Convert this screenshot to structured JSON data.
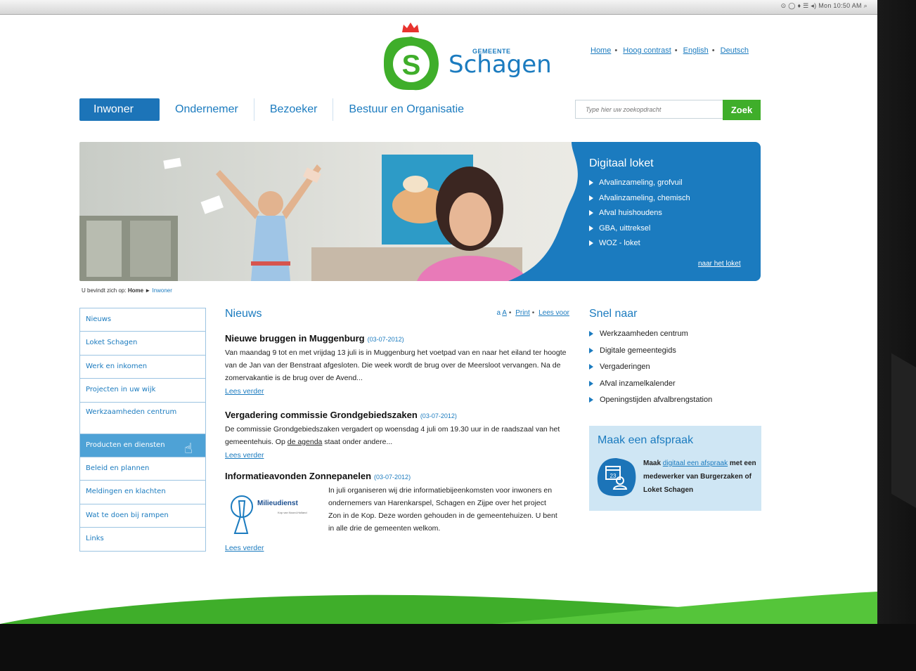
{
  "menubar": {
    "status": "⊙ ◯ ♦ ☰ ◂) Mon 10:50 AM ⌕"
  },
  "header": {
    "logo_small": "GEMEENTE",
    "logo_name": "Schagen",
    "links": [
      "Home",
      "Hoog contrast",
      "English",
      "Deutsch"
    ]
  },
  "nav": {
    "tabs": [
      "Inwoner",
      "Ondernemer",
      "Bezoeker",
      "Bestuur en Organisatie"
    ]
  },
  "search": {
    "placeholder": "Type hier uw zoekopdracht",
    "button": "Zoek"
  },
  "hero": {
    "title": "Digitaal loket",
    "items": [
      "Afvalinzameling, grofvuil",
      "Afvalinzameling, chemisch",
      "Afval huishoudens",
      "GBA, uittreksel",
      "WOZ - loket"
    ],
    "more": "naar het loket"
  },
  "breadcrumb": {
    "prefix": "U bevindt zich op:",
    "home": "Home",
    "sep": "►",
    "current": "Inwoner"
  },
  "sidebar": {
    "items": [
      "Nieuws",
      "Loket Schagen",
      "Werk en inkomen",
      "Projecten in uw wijk",
      "Werkzaamheden centrum",
      "Producten en diensten",
      "Beleid en plannen",
      "Meldingen en klachten",
      "Wat te doen bij rampen",
      "Links"
    ]
  },
  "news": {
    "title": "Nieuws",
    "tools": {
      "a_small": "a",
      "a_large": "A",
      "print": "Print",
      "read": "Lees voor"
    },
    "articles": [
      {
        "title": "Nieuwe bruggen in Muggenburg",
        "date": "(03-07-2012)",
        "body": "Van maandag 9 tot en met vrijdag 13 juli is in Muggenburg het voetpad van en naar het eiland ter hoogte van de Jan van der Benstraat afgesloten. Die week wordt de brug over de Meersloot vervangen. Na de zomervakantie is de brug over de Avend...",
        "more": "Lees verder"
      },
      {
        "title": "Vergadering commissie Grondgebiedszaken",
        "date": "(03-07-2012)",
        "body_before": "De commissie Grondgebiedszaken vergadert op woensdag 4 juli om 19.30 uur in de raadszaal van het gemeentehuis. Op ",
        "link": "de agenda",
        "body_after": " staat onder andere...",
        "more": "Lees verder"
      },
      {
        "title": "Informatieavonden Zonnepanelen",
        "date": "(03-07-2012)",
        "logo_text": "Milieudienst",
        "logo_sub": "Kop van Noord-Holland",
        "body": "In juli organiseren wij drie informatiebijeenkomsten voor inwoners en ondernemers van Harenkarspel, Schagen en Zijpe over het project Zon in de Kop. Deze worden gehouden in de gemeentehuizen. U bent in alle drie de gemeenten welkom.",
        "more": "Lees verder"
      }
    ]
  },
  "snel": {
    "title": "Snel naar",
    "items": [
      "Werkzaamheden centrum",
      "Digitale gemeentegids",
      "Vergaderingen",
      "Afval inzamelkalender",
      "Openingstijden afvalbrengstation"
    ]
  },
  "afspraak": {
    "title": "Maak een afspraak",
    "text_before": "Maak ",
    "link": "digitaal een afspraak",
    "text_after": " met een medewerker van Burgerzaken of Loket Schagen",
    "icon_number": "23"
  },
  "colors": {
    "brand_blue": "#1b7bbf",
    "nav_active": "#1c74b8",
    "green": "#3fae2a",
    "light_blue": "#cfe6f4"
  }
}
